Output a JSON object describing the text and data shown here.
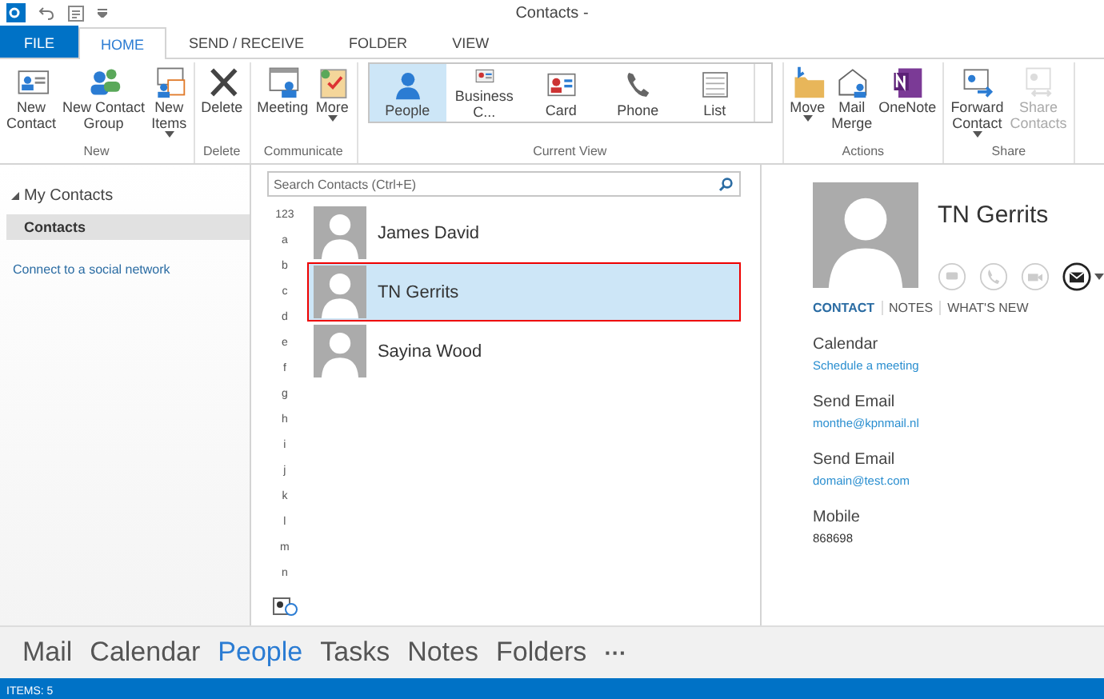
{
  "window": {
    "title": "Contacts -"
  },
  "ribbon_tabs": [
    {
      "label": "FILE",
      "kind": "file",
      "selected": false
    },
    {
      "label": "HOME",
      "kind": "tab",
      "selected": true
    },
    {
      "label": "SEND / RECEIVE",
      "kind": "tab",
      "selected": false
    },
    {
      "label": "FOLDER",
      "kind": "tab",
      "selected": false
    },
    {
      "label": "VIEW",
      "kind": "tab",
      "selected": false
    }
  ],
  "ribbon_groups": [
    {
      "label": "New",
      "kind": "buttons",
      "buttons": [
        {
          "label": "New\nContact",
          "dropdown": false,
          "disabled": false
        },
        {
          "label": "New Contact\nGroup",
          "dropdown": false,
          "disabled": false
        },
        {
          "label": "New\nItems",
          "dropdown": true,
          "disabled": false
        }
      ]
    },
    {
      "label": "Delete",
      "kind": "buttons",
      "buttons": [
        {
          "label": "Delete",
          "dropdown": false,
          "disabled": false
        }
      ]
    },
    {
      "label": "Communicate",
      "kind": "buttons",
      "buttons": [
        {
          "label": "Meeting",
          "dropdown": false,
          "disabled": false
        },
        {
          "label": "More",
          "dropdown": true,
          "disabled": false
        }
      ]
    },
    {
      "label": "Current View",
      "kind": "gallery",
      "items": [
        {
          "label": "People",
          "selected": true
        },
        {
          "label": "Business C...",
          "selected": false
        },
        {
          "label": "Card",
          "selected": false
        },
        {
          "label": "Phone",
          "selected": false
        },
        {
          "label": "List",
          "selected": false
        }
      ]
    },
    {
      "label": "Actions",
      "kind": "buttons",
      "buttons": [
        {
          "label": "Move",
          "dropdown": true,
          "disabled": false
        },
        {
          "label": "Mail\nMerge",
          "dropdown": false,
          "disabled": false
        },
        {
          "label": "OneNote",
          "dropdown": false,
          "disabled": false
        }
      ]
    },
    {
      "label": "Share",
      "kind": "buttons",
      "buttons": [
        {
          "label": "Forward\nContact",
          "dropdown": true,
          "disabled": false
        },
        {
          "label": "Share\nContacts",
          "dropdown": false,
          "disabled": true
        }
      ]
    }
  ],
  "sidebar": {
    "items": [
      {
        "label": "My Contacts",
        "expanded": true,
        "children": [
          {
            "label": "Contacts",
            "selected": true
          }
        ]
      }
    ],
    "link": "Connect to a social network"
  },
  "search": {
    "placeholder": "Search Contacts (Ctrl+E)"
  },
  "index": [
    "123",
    "a",
    "b",
    "c",
    "d",
    "e",
    "f",
    "g",
    "h",
    "i",
    "j",
    "k",
    "l",
    "m",
    "n"
  ],
  "contacts": [
    {
      "name": "James David",
      "selected": false
    },
    {
      "name": "TN Gerrits",
      "selected": true
    },
    {
      "name": "Sayina Wood",
      "selected": false
    }
  ],
  "details": {
    "name": "TN Gerrits",
    "actions": [
      {
        "kind": "chat",
        "disabled": true
      },
      {
        "kind": "phone",
        "disabled": true
      },
      {
        "kind": "video",
        "disabled": true
      },
      {
        "kind": "email",
        "disabled": false
      }
    ],
    "tabs": [
      {
        "label": "CONTACT",
        "selected": true
      },
      {
        "label": "NOTES",
        "selected": false
      },
      {
        "label": "WHAT'S NEW",
        "selected": false
      }
    ],
    "fields": [
      {
        "label": "Calendar",
        "value": "Schedule a meeting",
        "kind": "link"
      },
      {
        "label": "Send Email",
        "value": "monthe@kpnmail.nl",
        "kind": "link"
      },
      {
        "label": "Send Email",
        "value": "domain@test.com",
        "kind": "link"
      },
      {
        "label": "Mobile",
        "value": "868698",
        "kind": "text"
      }
    ]
  },
  "nav": {
    "items": [
      {
        "label": "Mail",
        "selected": false
      },
      {
        "label": "Calendar",
        "selected": false
      },
      {
        "label": "People",
        "selected": true
      },
      {
        "label": "Tasks",
        "selected": false
      },
      {
        "label": "Notes",
        "selected": false
      },
      {
        "label": "Folders",
        "selected": false
      }
    ],
    "more": "···"
  },
  "status_bar": {
    "text": "ITEMS: 5"
  }
}
